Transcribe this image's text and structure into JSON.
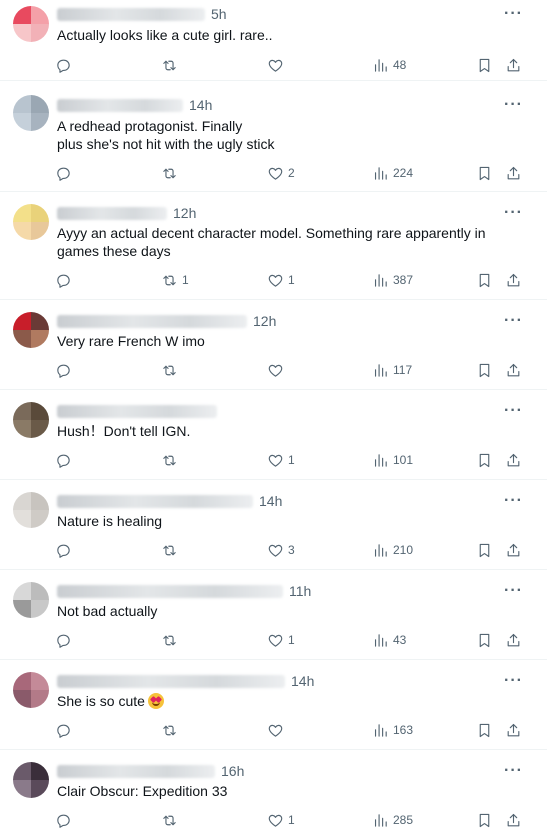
{
  "replies": [
    {
      "time": "5h",
      "text": "Actually looks like a cute girl. rare..",
      "reply_count": "",
      "repost_count": "",
      "like_count": "",
      "view_count": "48",
      "avatar_colors": [
        "#e84a5f",
        "#f4a0a8",
        "#f7c6c9",
        "#f2b1b7"
      ]
    },
    {
      "time": "14h",
      "text": "A redhead protagonist. Finally\nplus she's not hit with the ugly stick",
      "reply_count": "",
      "repost_count": "",
      "like_count": "2",
      "view_count": "224",
      "avatar_colors": [
        "#b8c4cf",
        "#9aa7b3",
        "#c5d0da",
        "#a7b3bf"
      ]
    },
    {
      "time": "12h",
      "text": "Ayyy an actual decent character model. Something rare apparently in\ngames these days",
      "reply_count": "",
      "repost_count": "1",
      "like_count": "1",
      "view_count": "387",
      "avatar_colors": [
        "#f3e08a",
        "#e9d27a",
        "#f5d9a8",
        "#e8c89a"
      ]
    },
    {
      "time": "12h",
      "text": "Very rare French W imo",
      "reply_count": "",
      "repost_count": "",
      "like_count": "",
      "view_count": "117",
      "avatar_colors": [
        "#c81e2a",
        "#6a3a36",
        "#8b5a4a",
        "#b07a60"
      ]
    },
    {
      "time": "",
      "text": "Hush！Don't tell IGN.",
      "reply_count": "",
      "repost_count": "",
      "like_count": "1",
      "view_count": "101",
      "avatar_colors": [
        "#7a6a5a",
        "#5a4a3a",
        "#8a7a66",
        "#6a5a48"
      ]
    },
    {
      "time": "14h",
      "text": "Nature is healing",
      "reply_count": "",
      "repost_count": "",
      "like_count": "3",
      "view_count": "210",
      "avatar_colors": [
        "#d9d6d2",
        "#c8c4bf",
        "#e2dfdb",
        "#cfcbc6"
      ]
    },
    {
      "time": "11h",
      "text": "Not bad actually",
      "reply_count": "",
      "repost_count": "",
      "like_count": "1",
      "view_count": "43",
      "avatar_colors": [
        "#d8d8d8",
        "#bcbcbc",
        "#9a9a9a",
        "#c8c8c8"
      ]
    },
    {
      "time": "14h",
      "text": "She is so cute",
      "reply_count": "",
      "repost_count": "",
      "like_count": "",
      "view_count": "163",
      "avatar_colors": [
        "#a8687a",
        "#c48a98",
        "#8a5a6a",
        "#b37a88"
      ]
    },
    {
      "time": "16h",
      "text": "Clair Obscur: Expedition 33",
      "reply_count": "",
      "repost_count": "",
      "like_count": "1",
      "view_count": "285",
      "avatar_colors": [
        "#6a5a6a",
        "#3a2e3a",
        "#8a7a8a",
        "#5a4a5a"
      ]
    }
  ],
  "icons": {
    "reply": "reply-icon",
    "repost": "repost-icon",
    "like": "heart-icon",
    "views": "views-icon",
    "bookmark": "bookmark-icon",
    "share": "share-icon",
    "more": "more-icon"
  },
  "colors": {
    "text": "#0f1419",
    "secondary": "#536471",
    "divider": "#eff3f4",
    "emoji_face": "#f6c23a",
    "emoji_hearts": "#e0245e"
  }
}
